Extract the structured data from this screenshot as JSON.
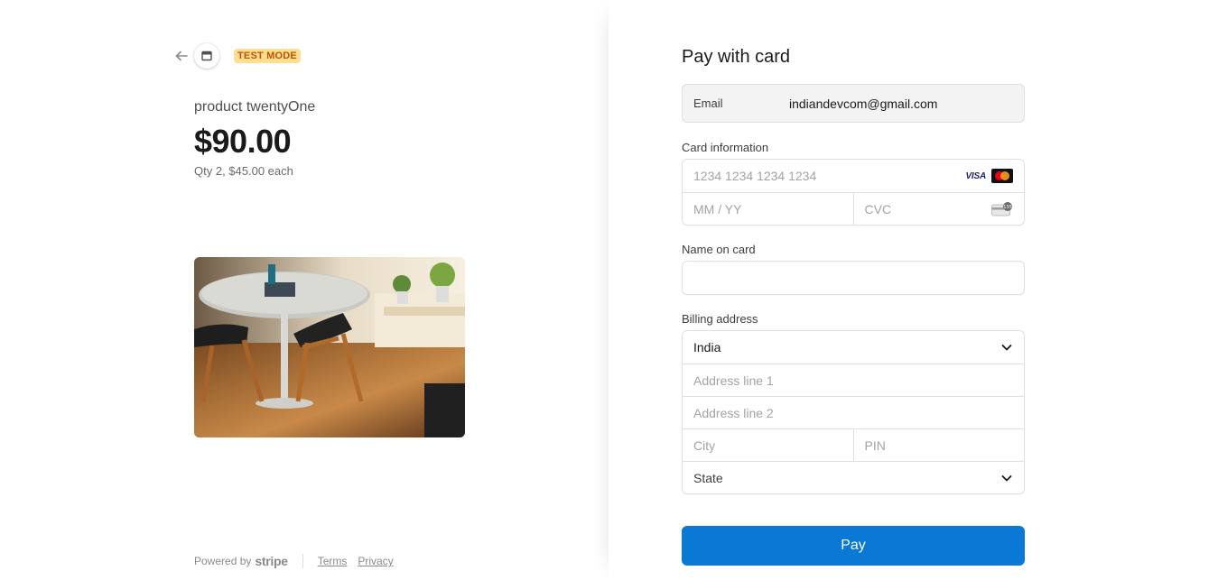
{
  "header": {
    "badge": "TEST MODE"
  },
  "product": {
    "name": "product twentyOne",
    "price": "$90.00",
    "quantity_line": "Qty 2, $45.00 each"
  },
  "footer": {
    "powered_by": "Powered by",
    "brand": "stripe",
    "terms": "Terms",
    "privacy": "Privacy"
  },
  "form": {
    "title": "Pay with card",
    "email_label": "Email",
    "email_value": "indiandevcom@gmail.com",
    "card_label": "Card information",
    "card_number_placeholder": "1234 1234 1234 1234",
    "card_brands": [
      "VISA",
      "mastercard-icon"
    ],
    "expiry_placeholder": "MM / YY",
    "cvc_placeholder": "CVC",
    "name_label": "Name on card",
    "name_value": "",
    "billing_label": "Billing address",
    "country_value": "India",
    "address1_placeholder": "Address line 1",
    "address2_placeholder": "Address line 2",
    "city_placeholder": "City",
    "pin_placeholder": "PIN",
    "state_placeholder": "State",
    "pay_label": "Pay"
  },
  "colors": {
    "accent": "#0074d4",
    "badge_bg": "#ffde92",
    "badge_text": "#bb5504"
  }
}
